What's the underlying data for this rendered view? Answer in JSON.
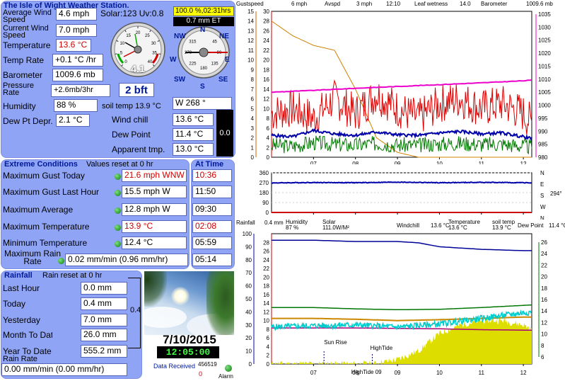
{
  "station_title": "The Isle of Wight Weather Station.",
  "labels": {
    "average_wind_speed": "Average Wind Speed",
    "current_wind_speed": "Current Wind Speed",
    "temperature": "Temperature",
    "temp_rate": "Temp Rate",
    "barometer": "Barometer",
    "pressure_rate": "Pressure Rate",
    "humidity": "Humidity",
    "dew_pt_depr": "Dew Pt Depr.",
    "wind_chill": "Wind chill",
    "dew_point": "Dew Point",
    "apparent_tmp": "Apparent tmp."
  },
  "values": {
    "average_wind_speed": "4.6 mph",
    "current_wind_speed": "7.0 mph",
    "temperature": "13.6 °C",
    "temp_rate": "+0.1 °C /hr",
    "barometer": "1009.6 mb",
    "pressure_rate": "+2.6mb/3hr",
    "humidity": "88 %",
    "dew_pt_depr": "2.1 °C",
    "wind_chill": "13.6 °C",
    "dew_point": "11.4 °C",
    "apparent_tmp": "13.0 °C",
    "solar_uv": "Solar:123 Uv:0.8",
    "percent_hrs": "100.0 %,02:31hrs",
    "et": "0.7 mm ET",
    "beaufort": "2 bft",
    "soil_temp": "soil temp 13.9 °C",
    "wind_dir": "W  268 °",
    "gauge_value": "4.1",
    "side_value": "0.0"
  },
  "gauge_ticks": [
    "0",
    "5",
    "10",
    "15",
    "20",
    "25",
    "30",
    "35",
    "40"
  ],
  "compass": {
    "points": [
      "N",
      "NE",
      "E",
      "SE",
      "S",
      "SW",
      "W",
      "NW"
    ],
    "degrees": [
      "45",
      "90",
      "135",
      "180",
      "225",
      "270",
      "315"
    ]
  },
  "extremes": {
    "title": "Extreme Conditions",
    "subtitle": "Values reset at 0 hr",
    "at_time": "At Time",
    "rows": [
      {
        "label": "Maximum Gust Today",
        "value": "21.6 mph WNW",
        "time": "10:36",
        "red": true
      },
      {
        "label": "Maximum Gust Last Hour",
        "value": "15.5 mph  W",
        "time": "11:50",
        "red": false
      },
      {
        "label": "Maximum Average",
        "value": "12.8 mph  W",
        "time": "09:30",
        "red": false
      },
      {
        "label": "Maximum Temperature",
        "value": "13.9 °C",
        "time": "02:08",
        "red": true
      },
      {
        "label": "Minimum Temperature",
        "value": "12.4 °C",
        "time": "05:59",
        "red": false
      },
      {
        "label": "Maximum Rain Rate",
        "value": "0.02 mm/min (0.96 mm/hr)",
        "time": "05:14",
        "red": false
      }
    ]
  },
  "rainfall": {
    "title": "Rainfall",
    "subtitle": "Rain reset at 0 hr",
    "side_value": "0.4",
    "rows": [
      {
        "label": "Last Hour",
        "value": "0.0 mm"
      },
      {
        "label": "Today",
        "value": "0.4 mm"
      },
      {
        "label": "Yesterday",
        "value": "7.0 mm"
      },
      {
        "label": "Month To Date",
        "value": "26.0 mm"
      },
      {
        "label": "Year To Date",
        "value": "555.2 mm"
      }
    ],
    "rain_rate_label": "Rain Rate",
    "rain_rate_value": "0.00 mm/min (0.00 mm/hr)"
  },
  "date": "7/10/2015",
  "time": "12:05:00",
  "data_received_label": "Data Received",
  "data_received_count": "456519",
  "data_received_zero": "0",
  "alarm_label": "Alarm",
  "colors": {
    "panel": "#8fa4f5",
    "gust": "#dd0000",
    "avspd": "#0000aa",
    "wind": "#007700",
    "leaf": "#d08000",
    "baro": "#ee00cc",
    "humidity": "#000099",
    "windchill": "#00cccc",
    "temperature": "#007700",
    "soil": "#cc8800",
    "dewpoint": "#aa0077",
    "solar": "#dddd00"
  },
  "chart_data": [
    {
      "type": "line",
      "title": "",
      "legend": [
        "Gustspeed",
        "6 mph",
        "Avspd",
        "3 mph",
        "12:10",
        "Leaf wetness",
        "14.0",
        "Barometer",
        "1009.6 mb"
      ],
      "x_ticks": [
        "07",
        "08",
        "09",
        "10",
        "11",
        "12"
      ],
      "y_left_ticks": [
        "0",
        "1",
        "2",
        "3",
        "4",
        "5",
        "6",
        "7",
        "8",
        "9",
        "10",
        "11",
        "12",
        "13",
        "14",
        "15"
      ],
      "y_mid_ticks": [
        "0",
        "2",
        "4",
        "6",
        "8",
        "10",
        "12",
        "14",
        "16",
        "18",
        "20",
        "22",
        "24",
        "26",
        "28",
        "30"
      ],
      "y_right_ticks": [
        "980",
        "985",
        "990",
        "995",
        "1000",
        "1005",
        "1010",
        "1015",
        "1020",
        "1025",
        "1030",
        "1035"
      ],
      "ylim_mid": [
        0,
        30
      ],
      "ylim_right": [
        980,
        1035
      ],
      "xlim": [
        6.0,
        12.2
      ],
      "series": [
        {
          "name": "Gustspeed",
          "x": [
            6.0,
            6.5,
            7.0,
            7.5,
            8.0,
            8.5,
            9.0,
            9.5,
            10.0,
            10.5,
            11.0,
            11.5,
            12.0,
            12.2
          ],
          "values": [
            9,
            10,
            8,
            12,
            9,
            13,
            10,
            8,
            11,
            12,
            10,
            11,
            9,
            7
          ]
        },
        {
          "name": "Avspd",
          "x": [
            6.0,
            6.5,
            7.0,
            7.5,
            8.0,
            8.5,
            9.0,
            9.5,
            10.0,
            10.5,
            11.0,
            11.5,
            12.0,
            12.2
          ],
          "values": [
            4.5,
            4.2,
            5.5,
            4.8,
            4.5,
            5.2,
            4.6,
            4.5,
            5.0,
            5.3,
            4.8,
            5.0,
            4.2,
            3.8
          ]
        },
        {
          "name": "Leaf wetness",
          "x": [
            6.0,
            6.5,
            7.0,
            7.5,
            8.0,
            8.5,
            9.0,
            9.5,
            10.0,
            10.5,
            11.0,
            11.5,
            12.0,
            12.2
          ],
          "values": [
            28,
            25,
            23,
            22,
            14,
            4,
            1,
            0,
            0,
            0,
            0,
            0,
            0,
            0
          ]
        },
        {
          "name": "Barometer",
          "x": [
            6.0,
            7.0,
            8.0,
            9.0,
            10.0,
            11.0,
            12.0,
            12.2
          ],
          "values": [
            1005.0,
            1005.7,
            1006.5,
            1007.2,
            1007.9,
            1008.6,
            1009.4,
            1009.6
          ]
        }
      ]
    },
    {
      "type": "line",
      "title": "",
      "x_ticks": [
        "07",
        "08",
        "09",
        "10",
        "11",
        "12"
      ],
      "y_left_ticks": [
        "0",
        "90",
        "180",
        "270",
        "360"
      ],
      "y_right_ticks": [
        "N",
        "W",
        "S",
        "E",
        "N"
      ],
      "right_value": "294°",
      "ylim": [
        0,
        360
      ],
      "xlim": [
        6.0,
        12.2
      ],
      "series": [
        {
          "name": "Wind direction",
          "x": [
            6.0,
            7.0,
            8.0,
            9.0,
            10.0,
            11.0,
            12.0,
            12.2
          ],
          "values": [
            268,
            272,
            270,
            275,
            270,
            273,
            270,
            268
          ]
        }
      ]
    },
    {
      "type": "line",
      "title": "",
      "legend": [
        "Rainfall",
        "0.4 mm",
        "Humidity",
        "87 %",
        "Solar",
        "111.0W/M²",
        "Windchill",
        "13.6 °C",
        "Temperature",
        "13.6 °C",
        "soil temp",
        "13.9 °C",
        "Dew Point",
        "11.4 °C"
      ],
      "annotations": [
        "Sun Rise",
        "HighTide",
        "HighTide 09"
      ],
      "x_ticks": [
        "07",
        "08",
        "09",
        "10",
        "11",
        "12"
      ],
      "y_left_ticks": [
        "0",
        "10",
        "20",
        "30",
        "40",
        "50",
        "60",
        "70",
        "80",
        "90",
        "100"
      ],
      "y_mid_ticks": [
        "0",
        "2",
        "4",
        "6",
        "8",
        "10",
        "12",
        "14",
        "16",
        "18",
        "20",
        "22",
        "24",
        "26",
        "28"
      ],
      "y_right_ticks": [
        "6",
        "8",
        "10",
        "12",
        "14",
        "16",
        "18",
        "20",
        "22",
        "24",
        "26"
      ],
      "ylim_left": [
        0,
        100
      ],
      "ylim_mid": [
        0,
        30
      ],
      "xlim": [
        6.0,
        12.2
      ],
      "series": [
        {
          "name": "Humidity",
          "x": [
            6.0,
            7.0,
            8.0,
            9.0,
            9.5,
            10.0,
            11.0,
            12.0,
            12.2
          ],
          "values": [
            95,
            95,
            94,
            94,
            93,
            90,
            88,
            87,
            87
          ]
        },
        {
          "name": "Windchill",
          "x": [
            6.0,
            7.0,
            8.0,
            9.0,
            10.0,
            11.0,
            12.0,
            12.2
          ],
          "values": [
            8.5,
            8.8,
            9.0,
            8.5,
            9.2,
            10.5,
            11.8,
            12.0
          ]
        },
        {
          "name": "Temperature",
          "x": [
            6.0,
            7.0,
            8.0,
            9.0,
            10.0,
            11.0,
            12.0,
            12.2
          ],
          "values": [
            13.0,
            13.0,
            12.7,
            12.5,
            12.6,
            13.0,
            13.5,
            13.6
          ]
        },
        {
          "name": "soil temp",
          "x": [
            6.0,
            7.0,
            8.0,
            9.0,
            10.0,
            11.0,
            12.0,
            12.2
          ],
          "values": [
            10.5,
            10.5,
            10.3,
            10.0,
            10.2,
            10.5,
            10.8,
            10.8
          ]
        },
        {
          "name": "Dew Point",
          "x": [
            6.0,
            7.0,
            8.0,
            9.0,
            10.0,
            11.0,
            12.0,
            12.2
          ],
          "values": [
            8.3,
            8.3,
            8.3,
            8.2,
            8.1,
            7.9,
            7.8,
            7.8
          ]
        },
        {
          "name": "Solar",
          "x": [
            6.0,
            8.4,
            9.0,
            9.5,
            10.0,
            10.5,
            11.0,
            11.5,
            12.0,
            12.2
          ],
          "values": [
            0,
            0,
            1,
            3,
            7,
            9,
            10,
            10,
            9,
            8
          ]
        }
      ]
    }
  ]
}
